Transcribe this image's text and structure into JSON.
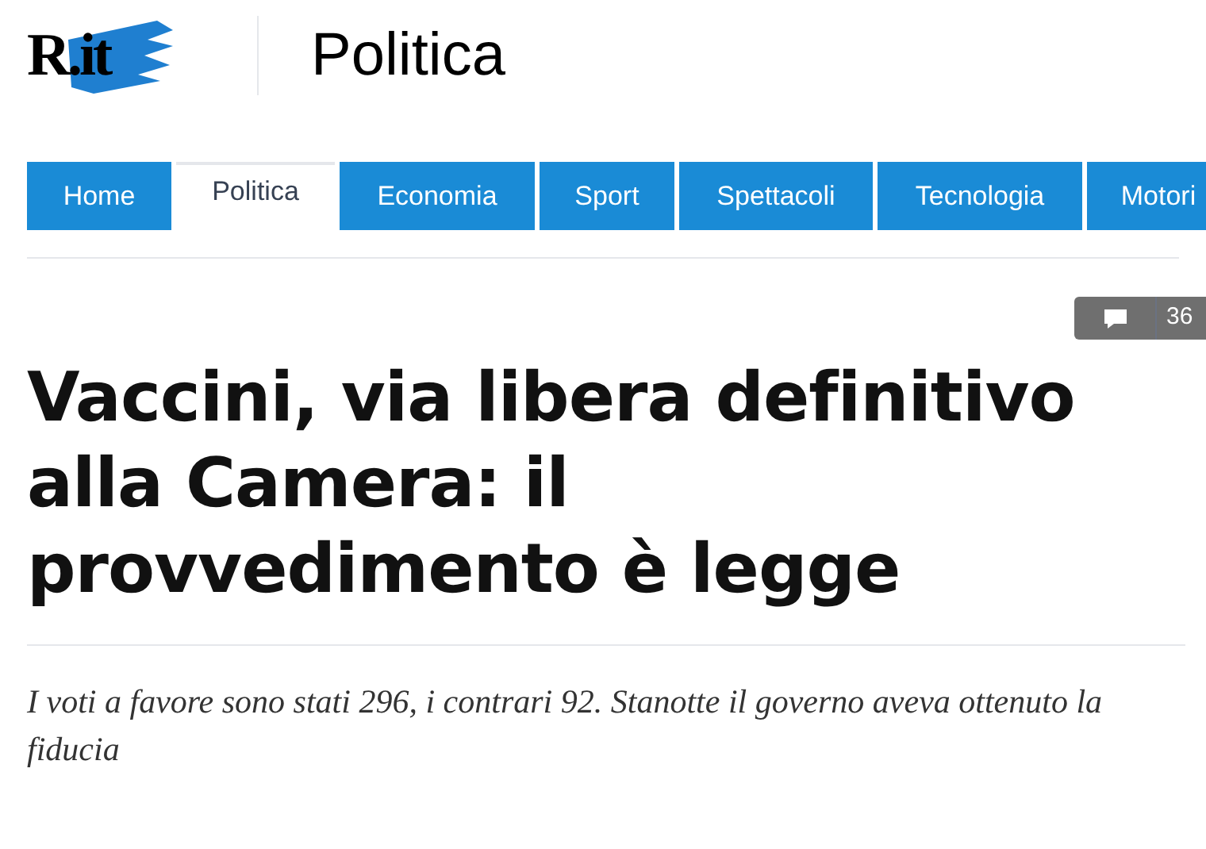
{
  "header": {
    "logo": "R.it",
    "section_title": "Politica"
  },
  "nav": {
    "tabs": [
      {
        "label": "Home",
        "selected": false
      },
      {
        "label": "Politica",
        "selected": true
      },
      {
        "label": "Economia",
        "selected": false
      },
      {
        "label": "Sport",
        "selected": false
      },
      {
        "label": "Spettacoli",
        "selected": false
      },
      {
        "label": "Tecnologia",
        "selected": false
      },
      {
        "label": "Motori",
        "selected": false
      }
    ]
  },
  "article": {
    "comment_count": "36",
    "headline": "Vaccini, via libera definitivo alla Camera: il provvedimento è legge",
    "summary": "I voti a favore sono stati 296, i contrari 92. Stanotte il governo aveva ottenuto la fiducia"
  }
}
